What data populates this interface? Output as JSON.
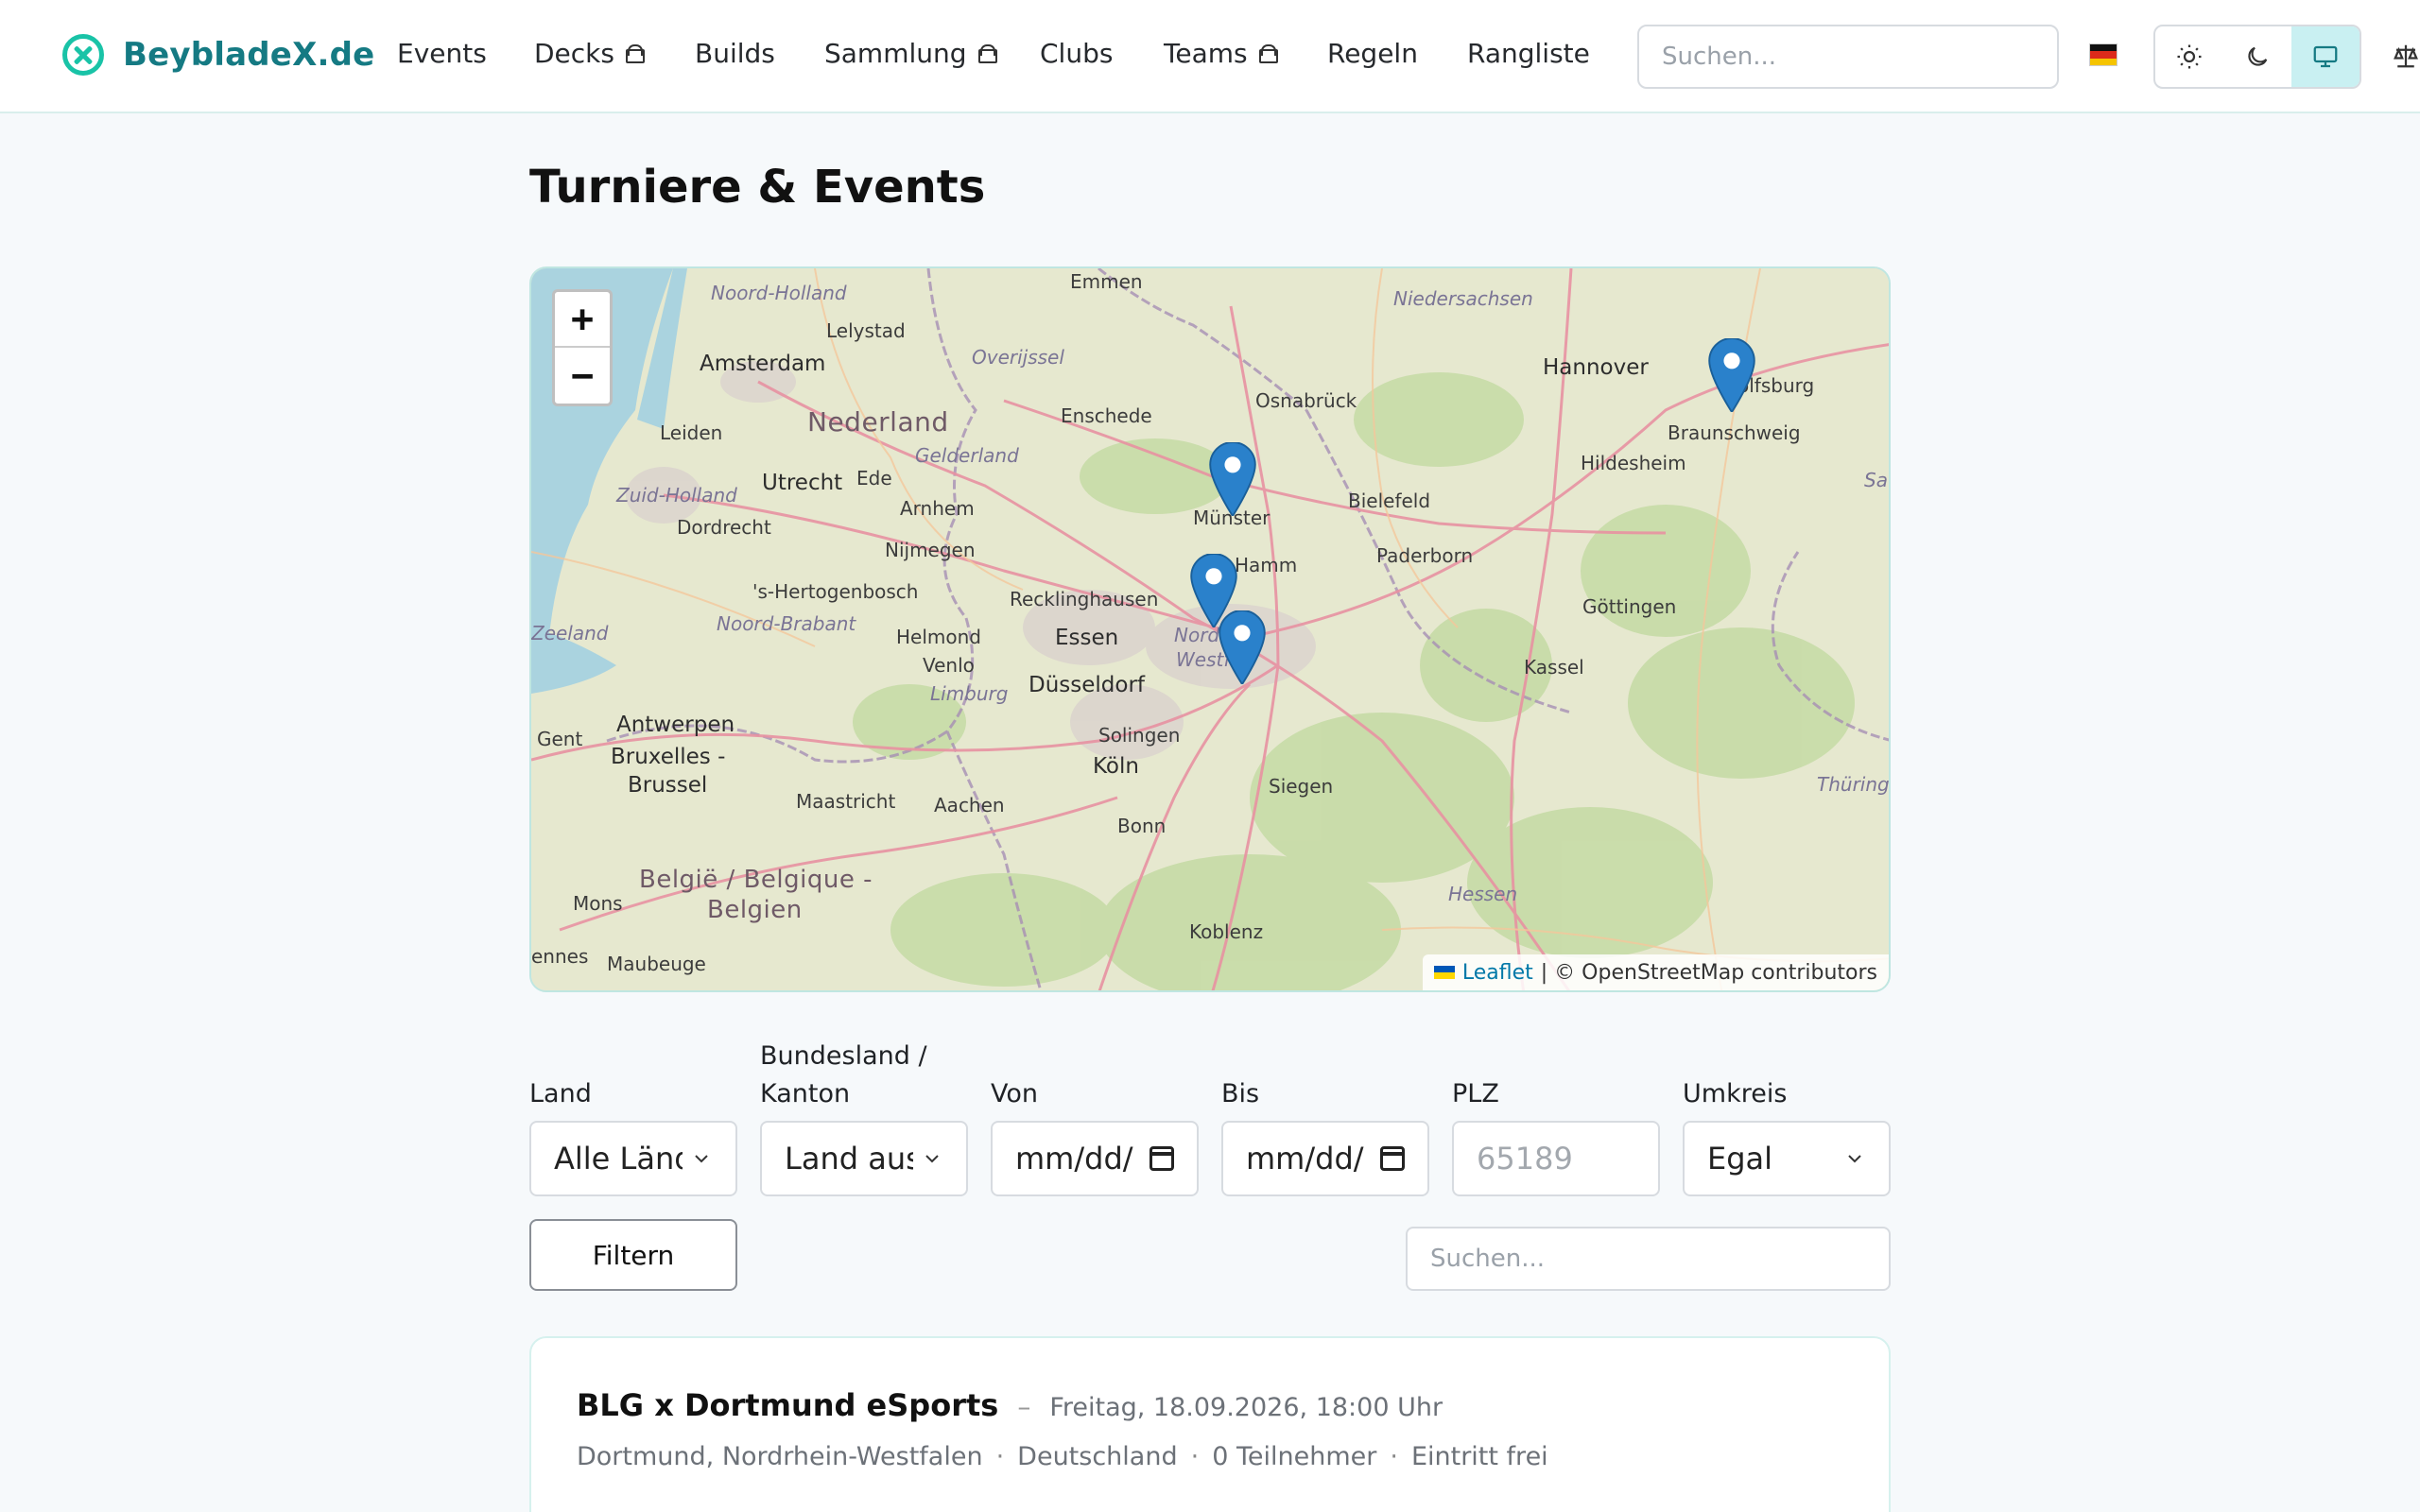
{
  "header": {
    "brand": "BeybladeX.de",
    "nav": [
      {
        "label": "Events",
        "locked": false
      },
      {
        "label": "Decks",
        "locked": true
      },
      {
        "label": "Builds",
        "locked": false
      },
      {
        "label": "Sammlung",
        "locked": true
      },
      {
        "label": "Clubs",
        "locked": false
      },
      {
        "label": "Teams",
        "locked": true
      },
      {
        "label": "Regeln",
        "locked": false
      },
      {
        "label": "Rangliste",
        "locked": false
      }
    ],
    "search_placeholder": "Suchen...",
    "language_flag": "de",
    "theme_options": [
      "light",
      "dark",
      "system"
    ],
    "active_theme": "system",
    "accent_color": "#19c3a7",
    "brand_color": "#157a83"
  },
  "page": {
    "title": "Turniere & Events"
  },
  "map": {
    "zoom_in": "+",
    "zoom_out": "−",
    "attribution_link": "Leaflet",
    "attribution_text": "| © OpenStreetMap contributors",
    "labels": {
      "noord_holland": "Noord-Holland",
      "lelystad": "Lelystad",
      "amsterdam": "Amsterdam",
      "overijssel": "Overijssel",
      "emmen": "Emmen",
      "niedersachsen": "Niedersachsen",
      "hannover": "Hannover",
      "wolfsburg": "olfsburg",
      "leiden": "Leiden",
      "nederland": "Nederland",
      "enschede": "Enschede",
      "osnabrueck": "Osnabrück",
      "braunschweig": "Braunschweig",
      "gelderland": "Gelderland",
      "hildesheim": "Hildesheim",
      "zuid_holland": "Zuid-Holland",
      "utrecht": "Utrecht",
      "ede": "Ede",
      "arnhem": "Arnhem",
      "muenster": "Münster",
      "bielefeld": "Bielefeld",
      "dordrecht": "Dordrecht",
      "nijmegen": "Nijmegen",
      "hamm": "Hamm",
      "paderborn": "Paderborn",
      "hertogenbosch": "'s-Hertogenbosch",
      "recklinghausen": "Recklinghausen",
      "goettingen": "Göttingen",
      "noord_brabant": "Noord-Brabant",
      "zeeland": "Zeeland",
      "helmond": "Helmond",
      "essen": "Essen",
      "nord": "Nord",
      "venlo": "Venlo",
      "westf": "Westf",
      "kassel": "Kassel",
      "duesseldorf": "Düsseldorf",
      "limburg": "Limburg",
      "antwerpen": "Antwerpen",
      "solingen": "Solingen",
      "gent": "Gent",
      "bruxelles": "Bruxelles -",
      "brussel": "Brussel",
      "koeln": "Köln",
      "siegen": "Siegen",
      "thuering": "Thüring",
      "maastricht": "Maastricht",
      "aachen": "Aachen",
      "bonn": "Bonn",
      "belgie": "België / Belgique -",
      "belgien": "Belgien",
      "hessen": "Hessen",
      "mons": "Mons",
      "koblenz": "Koblenz",
      "ennes": "ennes",
      "maubeuge": "Maubeuge",
      "sa": "Sa"
    }
  },
  "filters": {
    "land": {
      "label": "Land",
      "value": "Alle Länder"
    },
    "bundesland": {
      "label": "Bundesland / Kanton",
      "value": "Land auswählen"
    },
    "von": {
      "label": "Von",
      "value": "mm/dd/"
    },
    "bis": {
      "label": "Bis",
      "value": "mm/dd/"
    },
    "plz": {
      "label": "PLZ",
      "placeholder": "65189"
    },
    "umkreis": {
      "label": "Umkreis",
      "value": "Egal"
    },
    "filter_button": "Filtern",
    "search_placeholder": "Suchen..."
  },
  "events": [
    {
      "title": "BLG x Dortmund eSports",
      "separator": "–",
      "date": "Freitag, 18.09.2026, 18:00 Uhr",
      "location": "Dortmund, Nordrhein-Westfalen",
      "country": "Deutschland",
      "participants": "0 Teilnehmer",
      "entry": "Eintritt frei"
    }
  ]
}
